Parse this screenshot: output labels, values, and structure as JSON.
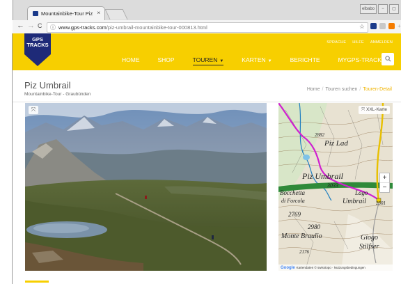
{
  "browser": {
    "tab_title": "Mountainbike-Tour Piz U",
    "tab_close": "×",
    "url_domain": "www.gps-tracks.com",
    "url_path": "/piz-umbrail-mountainbike-tour-000813.html",
    "window_user": "elbabo",
    "back": "←",
    "forward": "→",
    "reload": "C",
    "info_icon": "ⓘ",
    "bookmark_star": "☆"
  },
  "site": {
    "logo_line1": "GPS",
    "logo_line2": "TRACKS",
    "utility": [
      "SPRACHE",
      "HILFE",
      "ANMELDEN"
    ],
    "nav": [
      {
        "label": "HOME"
      },
      {
        "label": "SHOP"
      },
      {
        "label": "TOUREN"
      },
      {
        "label": "KARTEN"
      },
      {
        "label": "BERICHTE"
      },
      {
        "label": "MYGPS-TRACKS"
      }
    ],
    "accent_color": "#f7cf00"
  },
  "page": {
    "title": "Piz Umbrail",
    "subtitle": "Mountainbike-Tour - Graubünden",
    "breadcrumb": [
      "Home",
      "Touren suchen",
      "Touren-Detail"
    ]
  },
  "map": {
    "xxl_label": "XXL-Karte",
    "zoom_in": "+",
    "zoom_out": "−",
    "labels": [
      "2882",
      "Piz Lad",
      "Piz Umbrail",
      "3033",
      "Bocchetta",
      "di Forcola",
      "Lago",
      "Umbrail",
      "2769",
      "2980",
      "Monte Braulio",
      "Giogo",
      "Stilfser",
      "2501",
      "2176"
    ],
    "google": "Google",
    "attribution": "Kartendaten © swisstopo · Nutzungsbedingungen"
  }
}
